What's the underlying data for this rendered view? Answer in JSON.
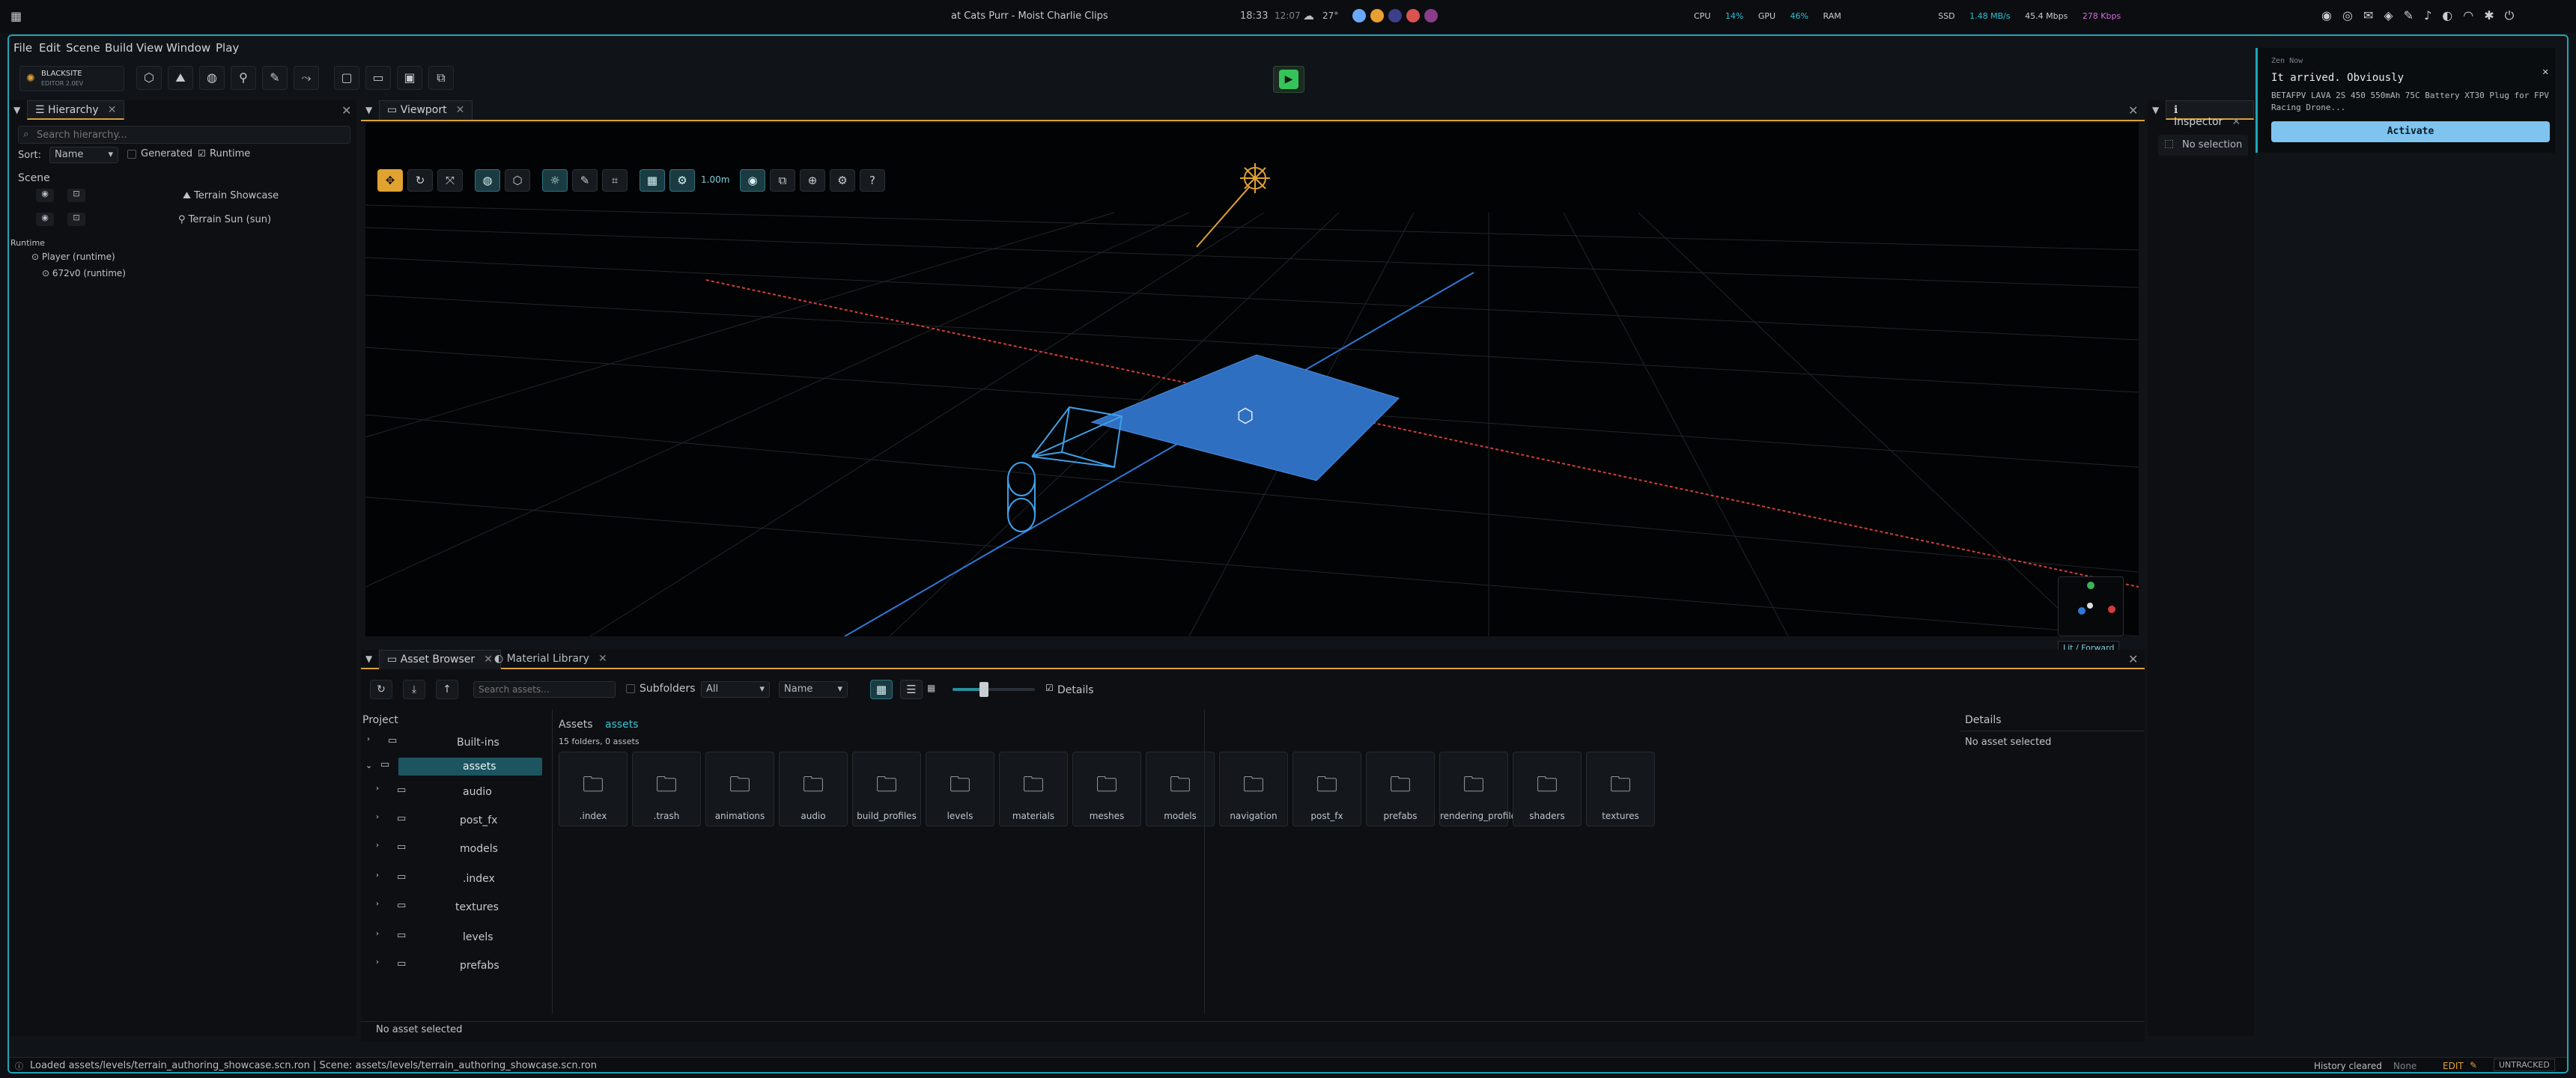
{
  "os_topbar": {
    "window_title": "at Cats Purr - Moist Charlie Clips",
    "time": "18:33",
    "time_secondary": "12:07",
    "weather_temp": "27°",
    "stats": {
      "cpu_label": "CPU",
      "cpu_value": "14%",
      "gpu_label": "GPU",
      "gpu_value": "46%",
      "ram_label": "RAM",
      "ssd_label": "SSD",
      "ssd_value": "1.48 MB/s",
      "net_down": "45.4 Mbps",
      "net_up": "278 Kbps"
    }
  },
  "notification": {
    "app": "Zen Now",
    "title": "It arrived. Obviously",
    "body": "BETAFPV LAVA 2S 450 550mAh 75C Battery XT30 Plug for FPV Racing Drone...",
    "action": "Activate"
  },
  "menu": [
    "File",
    "Edit",
    "Scene",
    "Build",
    "View",
    "Window",
    "Play"
  ],
  "brand": {
    "name": "BLACKSITE",
    "sub": "EDITOR 2.0EV"
  },
  "hierarchy": {
    "tab": "Hierarchy",
    "search_placeholder": "Search hierarchy...",
    "sort_label": "Sort:",
    "sort_value": "Name",
    "generated_label": "Generated",
    "runtime_label": "Runtime",
    "scene_header": "Scene",
    "scene_items": [
      "Terrain Showcase",
      "Terrain Sun  (sun)"
    ],
    "runtime_header": "Runtime",
    "runtime_items": [
      "Player  (runtime)",
      "672v0  (runtime)"
    ]
  },
  "viewport": {
    "tab": "Viewport",
    "grid_size": "1.00m",
    "render_mode": "Lit / Forward"
  },
  "inspector": {
    "tab": "Inspector",
    "empty": "No selection"
  },
  "asset_browser": {
    "tabs": [
      "Asset Browser",
      "Material Library"
    ],
    "search_placeholder": "Search assets...",
    "subfolders_label": "Subfolders",
    "filter_value": "All",
    "sort_value": "Name",
    "details_label": "Details",
    "project_header": "Project",
    "tree": [
      "Built-ins",
      "assets",
      "audio",
      "post_fx",
      "models",
      ".index",
      "textures",
      "levels",
      "prefabs"
    ],
    "breadcrumb_root": "Assets",
    "breadcrumb_current": "assets",
    "count": "15 folders, 0 assets",
    "folders": [
      ".index",
      ".trash",
      "animations",
      "audio",
      "build_profiles",
      "levels",
      "materials",
      "meshes",
      "models",
      "navigation",
      "post_fx",
      "prefabs",
      "rendering_profiles",
      "shaders",
      "textures"
    ],
    "details_header": "Details",
    "details_empty": "No asset selected",
    "footer_status": "No asset selected"
  },
  "statusbar": {
    "left": "Loaded assets/levels/terrain_authoring_showcase.scn.ron  |  Scene: assets/levels/terrain_authoring_showcase.scn.ron",
    "history": "History cleared",
    "history_value": "None",
    "mode": "EDIT",
    "vcs": "UNTRACKED"
  }
}
